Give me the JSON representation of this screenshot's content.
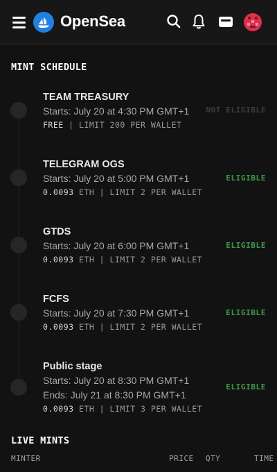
{
  "header": {
    "brand": "OpenSea",
    "icons": [
      "menu-icon",
      "opensea-logo",
      "search-icon",
      "bell-icon",
      "wallet-icon",
      "avatar"
    ]
  },
  "mint_schedule": {
    "title": "MINT SCHEDULE",
    "stages": [
      {
        "name": "TEAM TREASURY",
        "starts": "Starts: July 20 at 4:30 PM GMT+1",
        "price": "FREE",
        "limit": " | LIMIT 200 PER WALLET",
        "status": "NOT ELIGIBLE"
      },
      {
        "name": "TELEGRAM OGS",
        "starts": "Starts: July 20 at 5:00 PM GMT+1",
        "price": "0.0093",
        "limit": " ETH | LIMIT 2 PER WALLET",
        "status": "ELIGIBLE"
      },
      {
        "name": "GTDS",
        "starts": "Starts: July 20 at 6:00 PM GMT+1",
        "price": "0.0093",
        "limit": " ETH | LIMIT 2 PER WALLET",
        "status": "ELIGIBLE"
      },
      {
        "name": "FCFS",
        "starts": "Starts: July 20 at 7:30 PM GMT+1",
        "price": "0.0093",
        "limit": " ETH | LIMIT 2 PER WALLET",
        "status": "ELIGIBLE"
      },
      {
        "name": "Public stage",
        "starts": "Starts: July 20 at 8:30 PM GMT+1",
        "ends": "Ends: July 21 at 8:30 PM GMT+1",
        "price": "0.0093",
        "limit": " ETH | LIMIT 3 PER WALLET",
        "status": "ELIGIBLE"
      }
    ]
  },
  "live_mints": {
    "title": "LIVE MINTS",
    "columns": [
      "MINTER",
      "PRICE",
      "QTY",
      "TIME"
    ]
  },
  "colors": {
    "background": "#121212",
    "accent": "#2081e2",
    "eligible": "#3c9a4a"
  }
}
